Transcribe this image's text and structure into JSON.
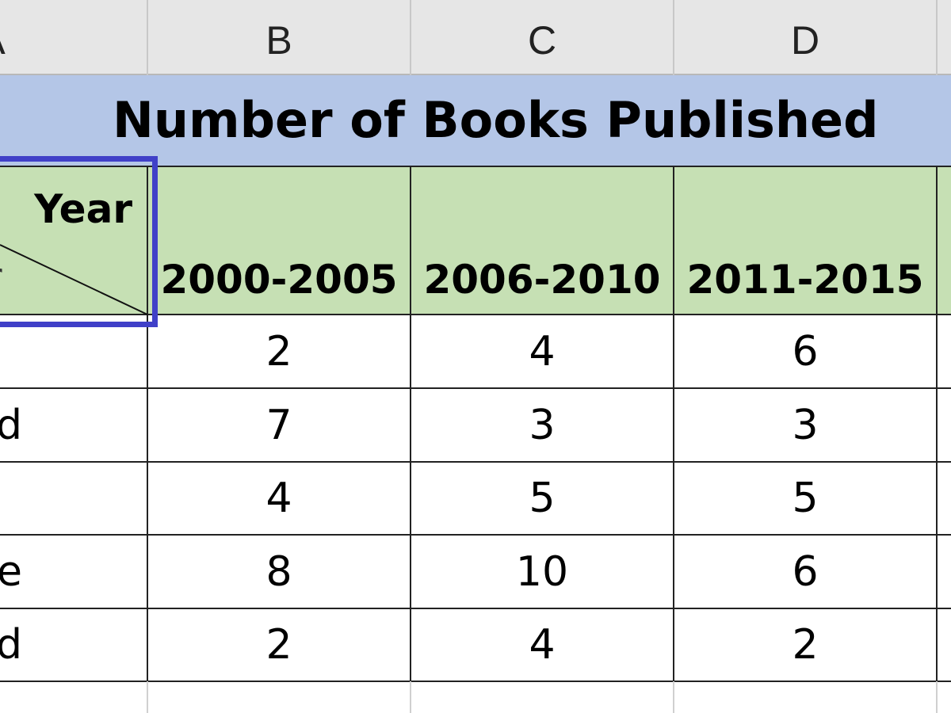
{
  "column_headers": [
    "A",
    "B",
    "C",
    "D"
  ],
  "title": "Number of Books Published",
  "header_row": {
    "corner_top": "Year",
    "corner_bottom": "r",
    "periods": [
      "2000-2005",
      "2006-2010",
      "2011-2015"
    ]
  },
  "rows": [
    {
      "a": "",
      "values": [
        "2",
        "4",
        "6"
      ]
    },
    {
      "a": "d",
      "values": [
        "7",
        "3",
        "3"
      ]
    },
    {
      "a": "",
      "values": [
        "4",
        "5",
        "5"
      ]
    },
    {
      "a": "e",
      "values": [
        "8",
        "10",
        "6"
      ]
    },
    {
      "a": "d",
      "values": [
        "2",
        "4",
        "2"
      ]
    }
  ],
  "colors": {
    "title_fill": "#b4c6e7",
    "header_fill": "#c6e0b4",
    "selection": "#4040c8",
    "column_header": "#e6e6e6"
  }
}
